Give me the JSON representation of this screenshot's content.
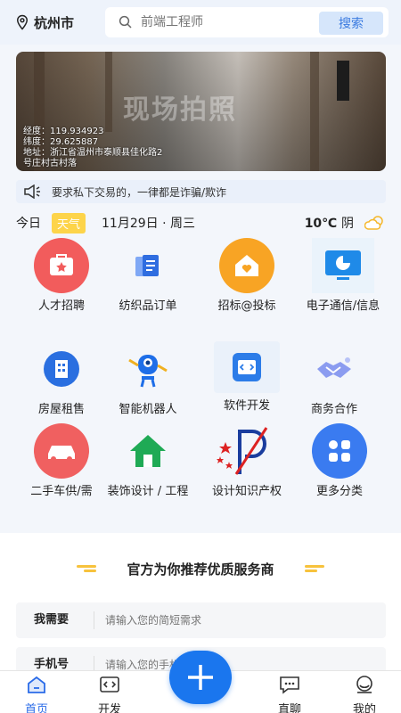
{
  "header": {
    "city": "杭州市",
    "search_placeholder": "前端工程师",
    "search_button": "搜索"
  },
  "banner": {
    "watermark": "现场拍照",
    "longitude": "经度：119.934923",
    "latitude": "纬度：29.625887",
    "address_1": "地址：浙江省温州市泰顺县佳化路2",
    "address_2": "号庄村古村落"
  },
  "notice": {
    "text": "要求私下交易的，一律都是诈骗/欺诈"
  },
  "dateline": {
    "today": "今日",
    "weather_badge": "天气",
    "date": "11月29日 · 周三",
    "temp": "10℃",
    "condition": "阴"
  },
  "categories": [
    {
      "label": "人才招聘",
      "icon": "briefcase-icon"
    },
    {
      "label": "纺织品订单",
      "icon": "document-icon"
    },
    {
      "label": "招标@投标",
      "icon": "house-heart-icon"
    },
    {
      "label": "电子通信/信息",
      "icon": "monitor-icon"
    },
    {
      "label": "房屋租售",
      "icon": "building-icon"
    },
    {
      "label": "智能机器人",
      "icon": "robot-icon"
    },
    {
      "label": "软件开发",
      "icon": "code-icon"
    },
    {
      "label": "商务合作",
      "icon": "handshake-icon"
    },
    {
      "label": "二手车供/需",
      "icon": "car-icon"
    },
    {
      "label": "装饰设计 / 工程",
      "icon": "home-icon"
    },
    {
      "label": "设计知识产权",
      "icon": "ip-logo-icon"
    },
    {
      "label": "更多分类",
      "icon": "more-icon"
    }
  ],
  "service": {
    "title": "官方为你推荐优质服务商",
    "need_label": "我需要",
    "need_placeholder": "请输入您的简短需求",
    "phone_label": "手机号",
    "phone_placeholder": "请输入您的手机号"
  },
  "tabs": [
    {
      "label": "首页",
      "icon": "home-icon"
    },
    {
      "label": "开发",
      "icon": "code-icon"
    },
    {
      "label": "直聊",
      "icon": "chat-icon"
    },
    {
      "label": "我的",
      "icon": "user-icon"
    }
  ],
  "colors": {
    "accent": "#1a76ee",
    "tab_active": "#2a6be8",
    "weather_badge": "#fdd44a"
  }
}
